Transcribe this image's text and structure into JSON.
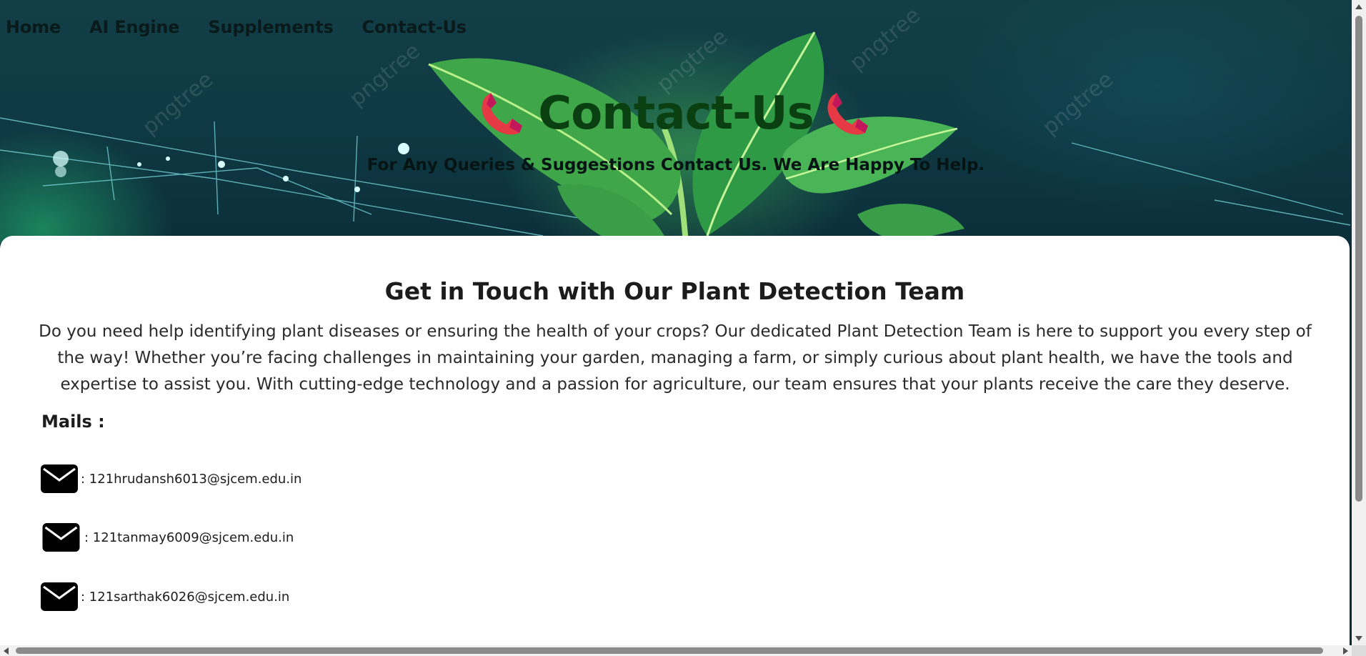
{
  "nav": {
    "items": [
      {
        "label": "Home"
      },
      {
        "label": "AI Engine"
      },
      {
        "label": "Supplements"
      },
      {
        "label": "Contact-Us"
      }
    ]
  },
  "hero": {
    "title": "Contact-Us",
    "subtitle": "For Any Queries & Suggestions Contact Us. We Are Happy To Help.",
    "phone_icon": "phone-icon",
    "watermark_text": "pngtree",
    "colors": {
      "title": "#0a3f12",
      "phone": "#e63946",
      "phone_accent": "#c2185b"
    }
  },
  "card": {
    "title": "Get in Touch with Our Plant Detection Team",
    "intro": "Do you need help identifying plant diseases or ensuring the health of your crops? Our dedicated Plant Detection Team is here to support you every step of the way! Whether you’re facing challenges in maintaining your garden, managing a farm, or simply curious about plant health, we have the tools and expertise to assist you. With cutting-edge technology and a passion for agriculture, our team ensures that your plants receive the care they deserve.",
    "mails_label": "Mails :",
    "mails": [
      {
        "address": ": 121hrudansh6013@sjcem.edu.in",
        "icon": "envelope-icon"
      },
      {
        "address": ": 121tanmay6009@sjcem.edu.in",
        "icon": "envelope-icon"
      },
      {
        "address": ": 121sarthak6026@sjcem.edu.in",
        "icon": "envelope-icon"
      }
    ]
  }
}
